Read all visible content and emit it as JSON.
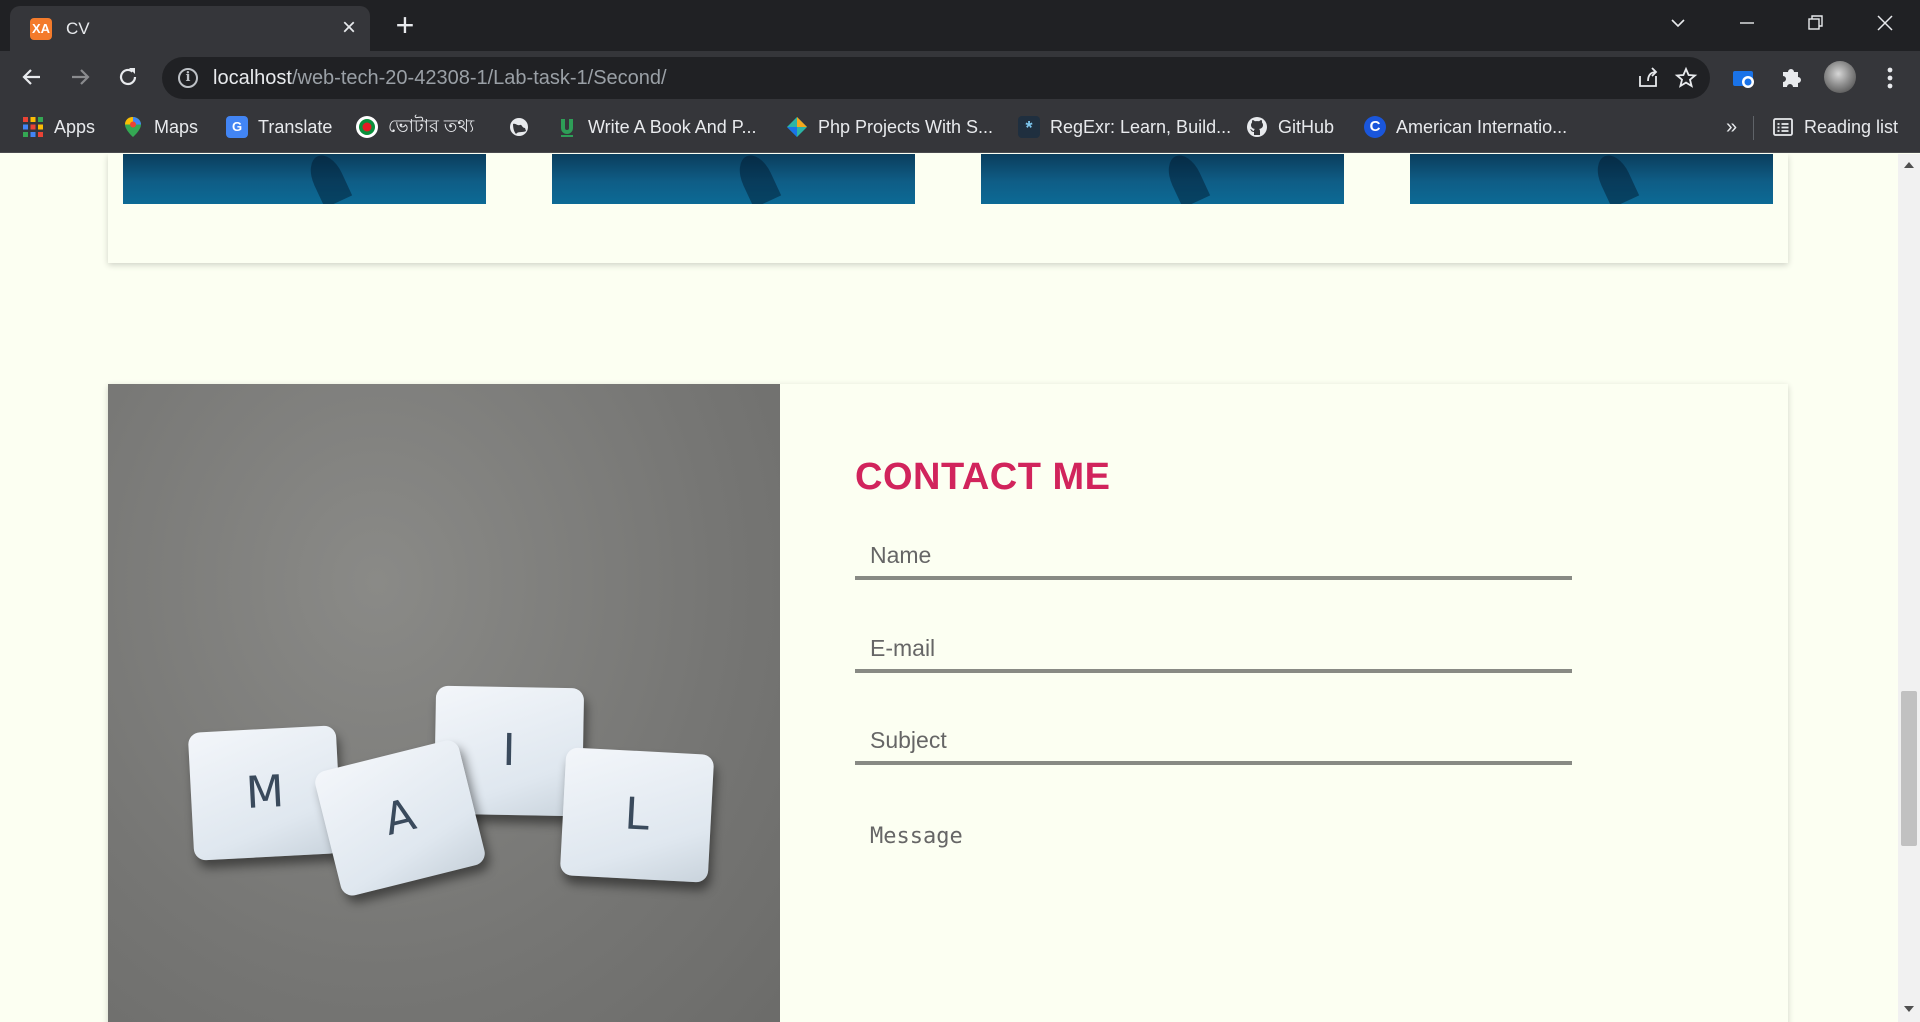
{
  "browser": {
    "tab_title": "CV",
    "tab_favicon_text": "XA",
    "url_host": "localhost",
    "url_path": "/web-tech-20-42308-1/Lab-task-1/Second/",
    "bookmarks": [
      {
        "label": "Apps",
        "icon": "apps-grid-icon"
      },
      {
        "label": "Maps",
        "icon": "maps-pin-icon"
      },
      {
        "label": "Translate",
        "icon": "translate-icon"
      },
      {
        "label": "ভোটার তথ্য",
        "icon": "voter-info-icon"
      },
      {
        "label": "",
        "icon": "globe-icon"
      },
      {
        "label": "Write A Book And P...",
        "icon": "book-icon"
      },
      {
        "label": "Php Projects With S...",
        "icon": "php-icon"
      },
      {
        "label": "RegExr: Learn, Build...",
        "icon": "regexr-icon"
      },
      {
        "label": "GitHub",
        "icon": "github-icon"
      },
      {
        "label": "American Internatio...",
        "icon": "aiub-icon"
      }
    ],
    "overflow_label": "»",
    "reading_list_label": "Reading list"
  },
  "contact": {
    "title": "CONTACT ME",
    "name_placeholder": "Name",
    "email_placeholder": "E-mail",
    "subject_placeholder": "Subject",
    "message_placeholder": "Message",
    "tiles": [
      "M",
      "A",
      "I",
      "L"
    ]
  },
  "colors": {
    "accent": "#d1245c",
    "page_bg": "#fcfff2",
    "field_underline": "#888a84"
  }
}
